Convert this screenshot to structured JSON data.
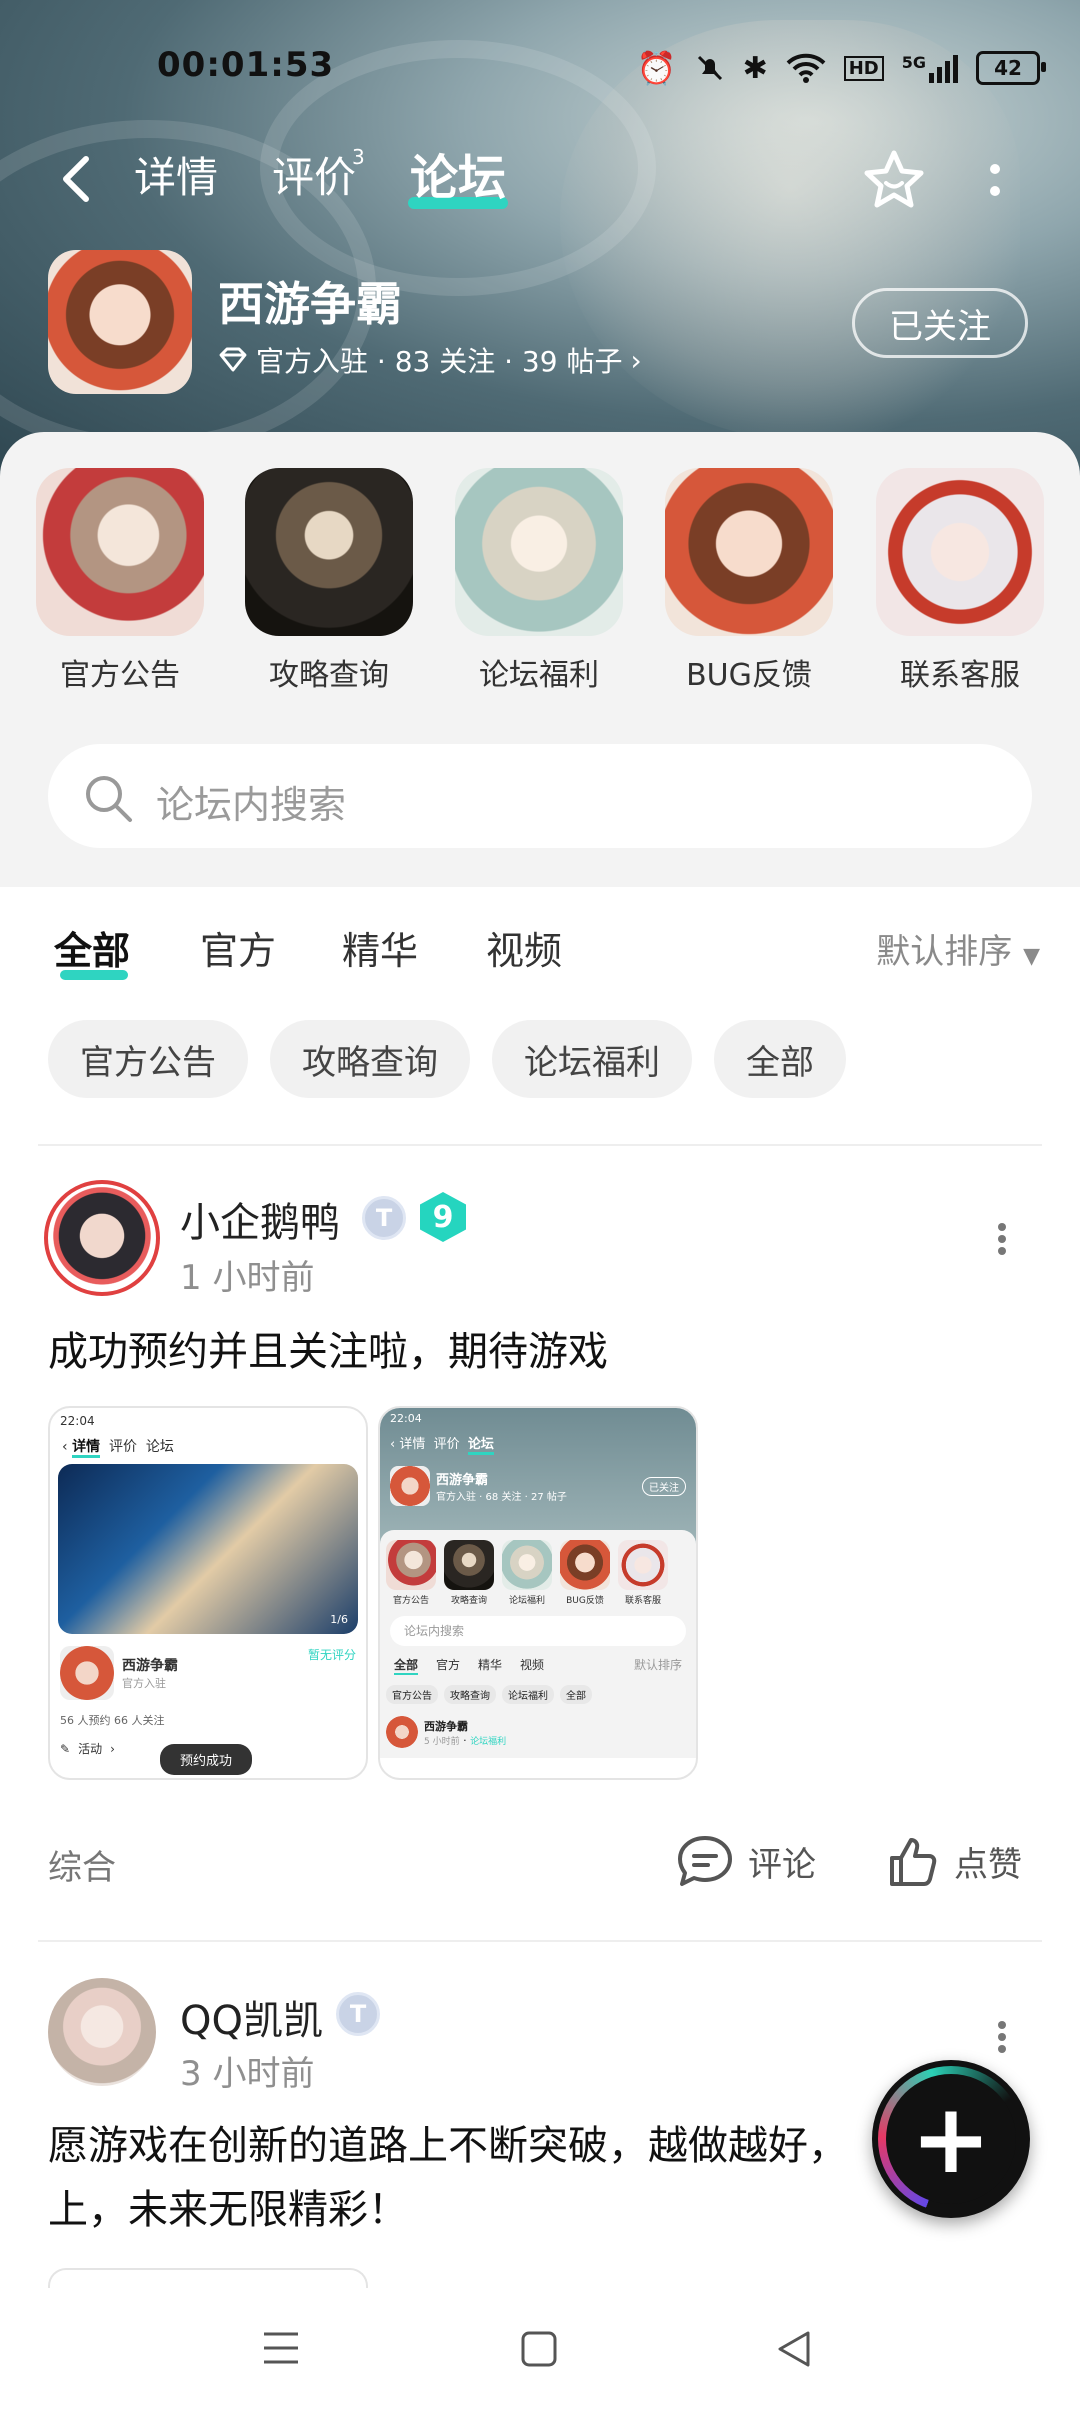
{
  "status_bar": {
    "time": "00:01:53",
    "battery": "42",
    "network": "5G",
    "hd": "HD"
  },
  "nav": {
    "tabs": [
      {
        "label": "详情"
      },
      {
        "label": "评价",
        "badge": "3"
      },
      {
        "label": "论坛"
      }
    ],
    "active_tab": "论坛"
  },
  "game": {
    "name": "西游争霸",
    "meta": "官方入驻 · 83 关注 · 39 帖子",
    "follow_label": "已关注"
  },
  "shortcuts": [
    {
      "label": "官方公告"
    },
    {
      "label": "攻略查询"
    },
    {
      "label": "论坛福利"
    },
    {
      "label": "BUG反馈"
    },
    {
      "label": "联系客服"
    }
  ],
  "search": {
    "placeholder": "论坛内搜索"
  },
  "filter_tabs": [
    {
      "label": "全部"
    },
    {
      "label": "官方"
    },
    {
      "label": "精华"
    },
    {
      "label": "视频"
    }
  ],
  "sort_label": "默认排序",
  "chips": [
    {
      "label": "官方公告"
    },
    {
      "label": "攻略查询"
    },
    {
      "label": "论坛福利"
    },
    {
      "label": "全部"
    }
  ],
  "posts": [
    {
      "author": "小企鹅鸭",
      "level": "9",
      "time": "1 小时前",
      "text": "成功预约并且关注啦，期待游戏",
      "category": "综合",
      "comment_label": "评论",
      "like_label": "点赞",
      "shot1": {
        "statusbar": "22:04",
        "tabs": [
          "详情",
          "评价",
          "论坛"
        ],
        "game": "西游争霸",
        "score": "暂无评分",
        "sub": "官方入驻",
        "stats": "56 人预约    66 人关注",
        "activity": "活动",
        "page": "1/6",
        "toast": "预约成功"
      },
      "shot2": {
        "statusbar": "22:04",
        "tabs": [
          "详情",
          "评价",
          "论坛"
        ],
        "game": "西游争霸",
        "meta": "官方入驻 · 68 关注 · 27 帖子",
        "follow": "已关注",
        "shortcuts": [
          "官方公告",
          "攻略查询",
          "论坛福利",
          "BUG反馈",
          "联系客服"
        ],
        "search": "论坛内搜索",
        "ftabs": [
          "全部",
          "官方",
          "精华",
          "视频"
        ],
        "sort": "默认排序",
        "chips": [
          "官方公告",
          "攻略查询",
          "论坛福利",
          "全部"
        ],
        "post_name": "西游争霸",
        "post_time": "5 小时前",
        "post_cat": "论坛福利"
      }
    },
    {
      "author": "QQ凯凯",
      "time": "3 小时前",
      "text_line1": "愿游戏在创新的道路上不断突破，越做越好，",
      "text_line2": "上，未来无限精彩！"
    }
  ],
  "colors": {
    "accent": "#2fd4c1",
    "level_badge": "#25d5bf"
  }
}
